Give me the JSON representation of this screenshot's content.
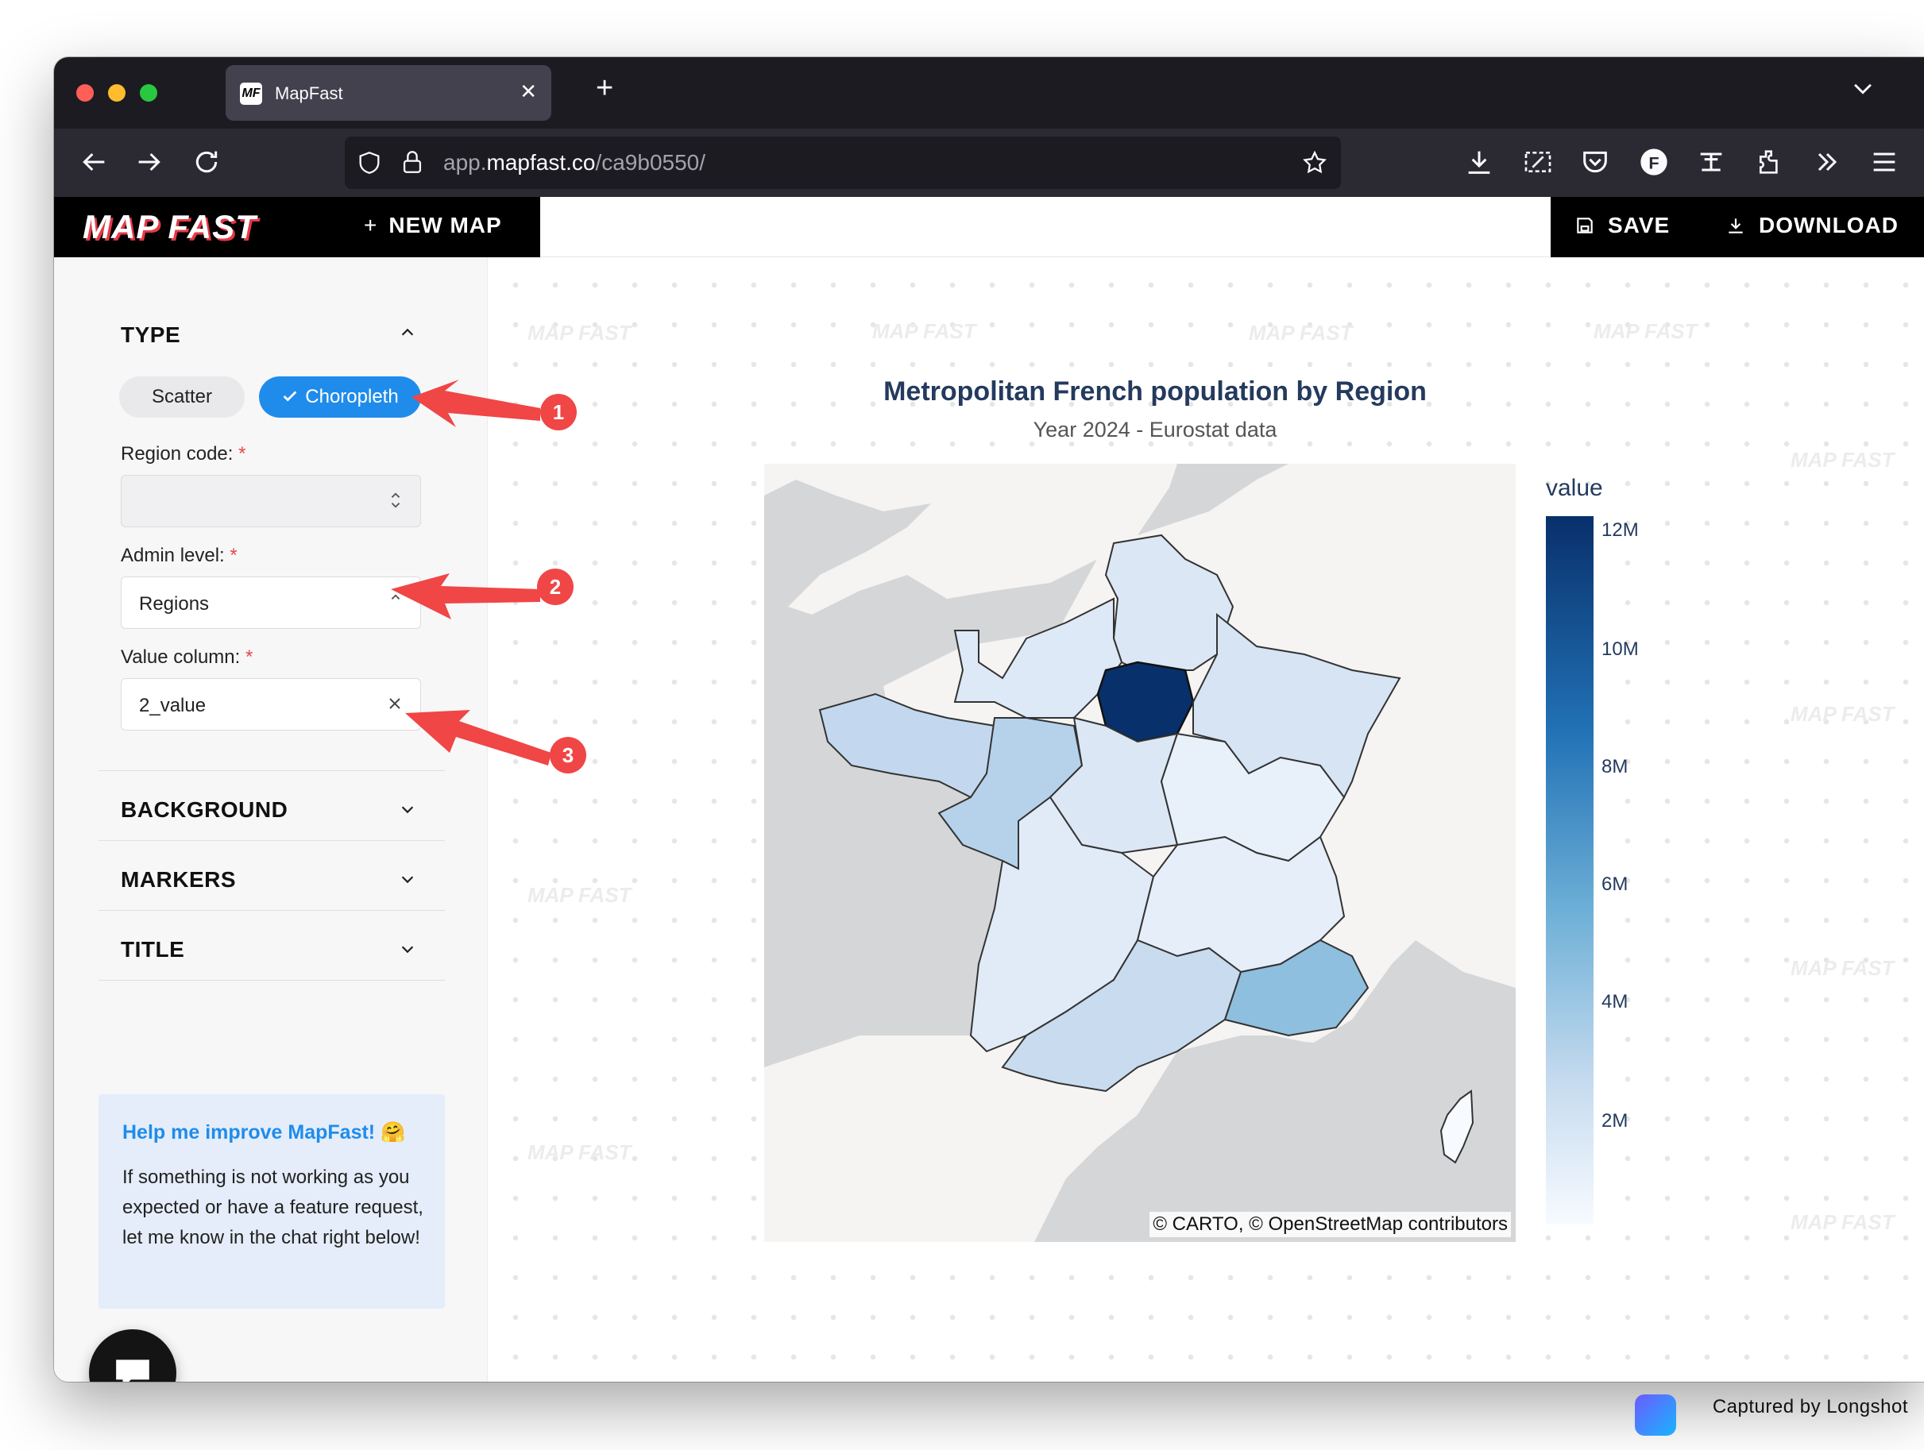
{
  "browser": {
    "tab_title": "MapFast",
    "tab_favicon": "MF",
    "url_prefix": "app.",
    "url_domain": "mapfast.co",
    "url_path": "/ca9b0550/"
  },
  "app": {
    "logo": "MAP FAST",
    "new_map_label": "NEW MAP",
    "save_label": "SAVE",
    "download_label": "DOWNLOAD"
  },
  "sidebar": {
    "type_title": "TYPE",
    "type_options": [
      "Scatter",
      "Choropleth"
    ],
    "selected_type": "Choropleth",
    "region_code_label": "Region code:",
    "region_code_value": "",
    "admin_level_label": "Admin level:",
    "admin_level_value": "Regions",
    "value_column_label": "Value column:",
    "value_column_value": "2_value",
    "required_mark": "*",
    "sections": [
      "BACKGROUND",
      "MARKERS",
      "TITLE"
    ],
    "help_title": "Help me improve MapFast! 🤗",
    "help_body": "If something is not working as you expected or have a feature request, let me know in the chat right below!"
  },
  "map": {
    "title": "Metropolitan French population by Region",
    "subtitle": "Year 2024 - Eurostat data",
    "attribution": "© CARTO, © OpenStreetMap contributors",
    "legend_title": "value",
    "legend_ticks": [
      "12M",
      "10M",
      "8M",
      "6M",
      "4M",
      "2M"
    ],
    "watermark": "MAP FAST",
    "colors": {
      "ile_de_france": "#08306b",
      "paca": "#8fbfdf",
      "bretagne": "#c3d8ee",
      "pays_de_la_loire": "#b6d1ea",
      "occitanie": "#c8dbef",
      "light": "#dde9f6",
      "lighter": "#e8f0fa",
      "corse": "#f7fbff"
    }
  },
  "annotations": [
    "1",
    "2",
    "3"
  ],
  "footer": {
    "capture_label": "Captured by Longshot"
  }
}
